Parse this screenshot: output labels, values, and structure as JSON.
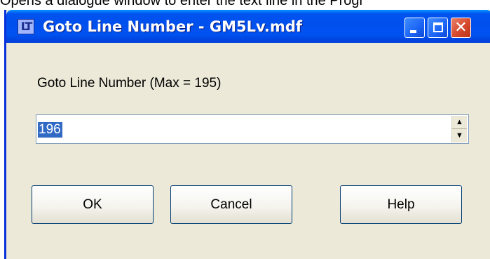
{
  "caption": "Opens a dialogue window to enter the text line in the Progr",
  "window": {
    "title": "Goto Line Number - GM5Lv.mdf",
    "icon": "app-logo-icon",
    "icon_text": "LT",
    "controls": {
      "minimize": "minimize-icon",
      "maximize": "maximize-icon",
      "close": "close-icon",
      "close_glyph": "✕"
    }
  },
  "dialog": {
    "prompt": "Goto Line Number  (Max = 195)",
    "line_input": {
      "value": "196",
      "spin_up": "▲",
      "spin_down": "▼"
    },
    "buttons": {
      "ok": "OK",
      "cancel": "Cancel",
      "help": "Help"
    }
  },
  "colors": {
    "titlebar": "#0053ee",
    "window_bg": "#ece9d8",
    "close_button": "#d6492c",
    "selection": "#316ac5"
  }
}
